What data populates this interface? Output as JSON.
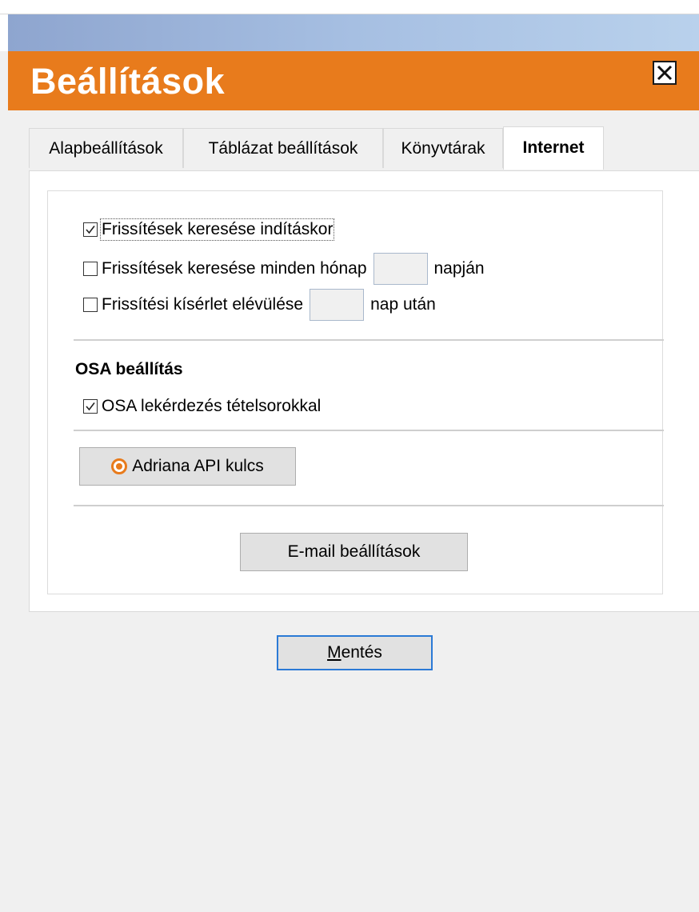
{
  "window": {
    "title": "Beállítások",
    "close_icon": "close-icon",
    "accent_color": "#e87b1c"
  },
  "tabs": [
    {
      "label": "Alapbeállítások",
      "active": false
    },
    {
      "label": "Táblázat beállítások",
      "active": false
    },
    {
      "label": "Könyvtárak",
      "active": false
    },
    {
      "label": "Internet",
      "active": true
    }
  ],
  "internet": {
    "check_on_start": {
      "label": "Frissítések keresése indításkor",
      "checked": true
    },
    "check_monthly": {
      "label": "Frissítések keresése minden hónap",
      "value": "",
      "suffix": "napján",
      "checked": false
    },
    "expiry": {
      "label": "Frissítési kísérlet elévülése",
      "value": "",
      "suffix": "nap után",
      "checked": false
    },
    "osa_section_title": "OSA beállítás",
    "osa_query": {
      "label": "OSA lekérdezés tételsorokkal",
      "checked": true
    },
    "api_key_button": "Adriana API kulcs",
    "email_button": "E-mail beállítások"
  },
  "footer": {
    "save_prefix": "M",
    "save_rest": "entés"
  }
}
